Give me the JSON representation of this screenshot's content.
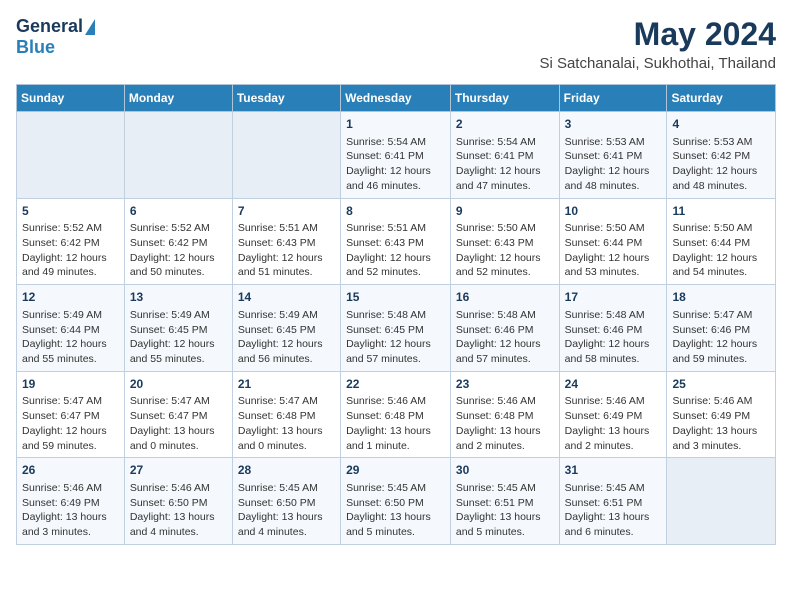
{
  "header": {
    "logo_general": "General",
    "logo_blue": "Blue",
    "title": "May 2024",
    "subtitle": "Si Satchanalai, Sukhothai, Thailand"
  },
  "weekdays": [
    "Sunday",
    "Monday",
    "Tuesday",
    "Wednesday",
    "Thursday",
    "Friday",
    "Saturday"
  ],
  "weeks": [
    [
      {
        "day": "",
        "lines": []
      },
      {
        "day": "",
        "lines": []
      },
      {
        "day": "",
        "lines": []
      },
      {
        "day": "1",
        "lines": [
          "Sunrise: 5:54 AM",
          "Sunset: 6:41 PM",
          "Daylight: 12 hours",
          "and 46 minutes."
        ]
      },
      {
        "day": "2",
        "lines": [
          "Sunrise: 5:54 AM",
          "Sunset: 6:41 PM",
          "Daylight: 12 hours",
          "and 47 minutes."
        ]
      },
      {
        "day": "3",
        "lines": [
          "Sunrise: 5:53 AM",
          "Sunset: 6:41 PM",
          "Daylight: 12 hours",
          "and 48 minutes."
        ]
      },
      {
        "day": "4",
        "lines": [
          "Sunrise: 5:53 AM",
          "Sunset: 6:42 PM",
          "Daylight: 12 hours",
          "and 48 minutes."
        ]
      }
    ],
    [
      {
        "day": "5",
        "lines": [
          "Sunrise: 5:52 AM",
          "Sunset: 6:42 PM",
          "Daylight: 12 hours",
          "and 49 minutes."
        ]
      },
      {
        "day": "6",
        "lines": [
          "Sunrise: 5:52 AM",
          "Sunset: 6:42 PM",
          "Daylight: 12 hours",
          "and 50 minutes."
        ]
      },
      {
        "day": "7",
        "lines": [
          "Sunrise: 5:51 AM",
          "Sunset: 6:43 PM",
          "Daylight: 12 hours",
          "and 51 minutes."
        ]
      },
      {
        "day": "8",
        "lines": [
          "Sunrise: 5:51 AM",
          "Sunset: 6:43 PM",
          "Daylight: 12 hours",
          "and 52 minutes."
        ]
      },
      {
        "day": "9",
        "lines": [
          "Sunrise: 5:50 AM",
          "Sunset: 6:43 PM",
          "Daylight: 12 hours",
          "and 52 minutes."
        ]
      },
      {
        "day": "10",
        "lines": [
          "Sunrise: 5:50 AM",
          "Sunset: 6:44 PM",
          "Daylight: 12 hours",
          "and 53 minutes."
        ]
      },
      {
        "day": "11",
        "lines": [
          "Sunrise: 5:50 AM",
          "Sunset: 6:44 PM",
          "Daylight: 12 hours",
          "and 54 minutes."
        ]
      }
    ],
    [
      {
        "day": "12",
        "lines": [
          "Sunrise: 5:49 AM",
          "Sunset: 6:44 PM",
          "Daylight: 12 hours",
          "and 55 minutes."
        ]
      },
      {
        "day": "13",
        "lines": [
          "Sunrise: 5:49 AM",
          "Sunset: 6:45 PM",
          "Daylight: 12 hours",
          "and 55 minutes."
        ]
      },
      {
        "day": "14",
        "lines": [
          "Sunrise: 5:49 AM",
          "Sunset: 6:45 PM",
          "Daylight: 12 hours",
          "and 56 minutes."
        ]
      },
      {
        "day": "15",
        "lines": [
          "Sunrise: 5:48 AM",
          "Sunset: 6:45 PM",
          "Daylight: 12 hours",
          "and 57 minutes."
        ]
      },
      {
        "day": "16",
        "lines": [
          "Sunrise: 5:48 AM",
          "Sunset: 6:46 PM",
          "Daylight: 12 hours",
          "and 57 minutes."
        ]
      },
      {
        "day": "17",
        "lines": [
          "Sunrise: 5:48 AM",
          "Sunset: 6:46 PM",
          "Daylight: 12 hours",
          "and 58 minutes."
        ]
      },
      {
        "day": "18",
        "lines": [
          "Sunrise: 5:47 AM",
          "Sunset: 6:46 PM",
          "Daylight: 12 hours",
          "and 59 minutes."
        ]
      }
    ],
    [
      {
        "day": "19",
        "lines": [
          "Sunrise: 5:47 AM",
          "Sunset: 6:47 PM",
          "Daylight: 12 hours",
          "and 59 minutes."
        ]
      },
      {
        "day": "20",
        "lines": [
          "Sunrise: 5:47 AM",
          "Sunset: 6:47 PM",
          "Daylight: 13 hours",
          "and 0 minutes."
        ]
      },
      {
        "day": "21",
        "lines": [
          "Sunrise: 5:47 AM",
          "Sunset: 6:48 PM",
          "Daylight: 13 hours",
          "and 0 minutes."
        ]
      },
      {
        "day": "22",
        "lines": [
          "Sunrise: 5:46 AM",
          "Sunset: 6:48 PM",
          "Daylight: 13 hours",
          "and 1 minute."
        ]
      },
      {
        "day": "23",
        "lines": [
          "Sunrise: 5:46 AM",
          "Sunset: 6:48 PM",
          "Daylight: 13 hours",
          "and 2 minutes."
        ]
      },
      {
        "day": "24",
        "lines": [
          "Sunrise: 5:46 AM",
          "Sunset: 6:49 PM",
          "Daylight: 13 hours",
          "and 2 minutes."
        ]
      },
      {
        "day": "25",
        "lines": [
          "Sunrise: 5:46 AM",
          "Sunset: 6:49 PM",
          "Daylight: 13 hours",
          "and 3 minutes."
        ]
      }
    ],
    [
      {
        "day": "26",
        "lines": [
          "Sunrise: 5:46 AM",
          "Sunset: 6:49 PM",
          "Daylight: 13 hours",
          "and 3 minutes."
        ]
      },
      {
        "day": "27",
        "lines": [
          "Sunrise: 5:46 AM",
          "Sunset: 6:50 PM",
          "Daylight: 13 hours",
          "and 4 minutes."
        ]
      },
      {
        "day": "28",
        "lines": [
          "Sunrise: 5:45 AM",
          "Sunset: 6:50 PM",
          "Daylight: 13 hours",
          "and 4 minutes."
        ]
      },
      {
        "day": "29",
        "lines": [
          "Sunrise: 5:45 AM",
          "Sunset: 6:50 PM",
          "Daylight: 13 hours",
          "and 5 minutes."
        ]
      },
      {
        "day": "30",
        "lines": [
          "Sunrise: 5:45 AM",
          "Sunset: 6:51 PM",
          "Daylight: 13 hours",
          "and 5 minutes."
        ]
      },
      {
        "day": "31",
        "lines": [
          "Sunrise: 5:45 AM",
          "Sunset: 6:51 PM",
          "Daylight: 13 hours",
          "and 6 minutes."
        ]
      },
      {
        "day": "",
        "lines": []
      }
    ]
  ]
}
